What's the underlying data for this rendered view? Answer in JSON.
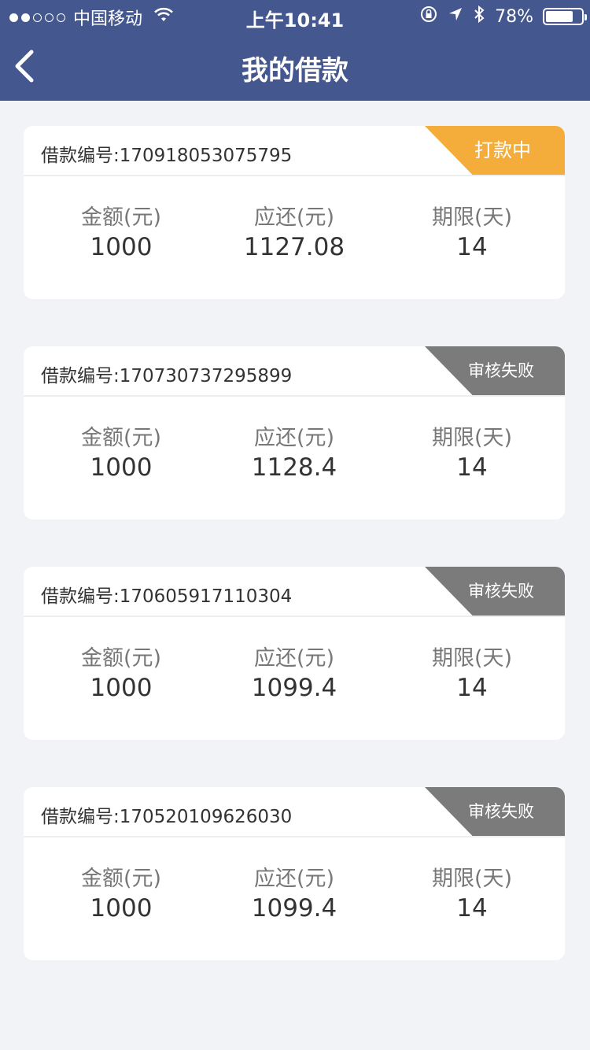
{
  "status_bar": {
    "carrier": "中国移动",
    "time": "上午10:41",
    "battery": "78%"
  },
  "nav": {
    "title": "我的借款",
    "back_icon": "chevron-left-icon"
  },
  "labels": {
    "amount": "金额(元)",
    "repay": "应还(元)",
    "term": "期限(天)"
  },
  "loans": [
    {
      "id_text": "借款编号:170918053075795",
      "status": "打款中",
      "status_color": "#f4ad3b",
      "amount": "1000",
      "repay": "1127.08",
      "term": "14"
    },
    {
      "id_text": "借款编号:170730737295899",
      "status": "审核失败",
      "status_color": "#7b7b7b",
      "amount": "1000",
      "repay": "1128.4",
      "term": "14"
    },
    {
      "id_text": "借款编号:170605917110304",
      "status": "审核失败",
      "status_color": "#7b7b7b",
      "amount": "1000",
      "repay": "1099.4",
      "term": "14"
    },
    {
      "id_text": "借款编号:170520109626030",
      "status": "审核失败",
      "status_color": "#7b7b7b",
      "amount": "1000",
      "repay": "1099.4",
      "term": "14"
    }
  ],
  "colors": {
    "header_bg": "#44578f",
    "page_bg": "#f2f3f7"
  }
}
